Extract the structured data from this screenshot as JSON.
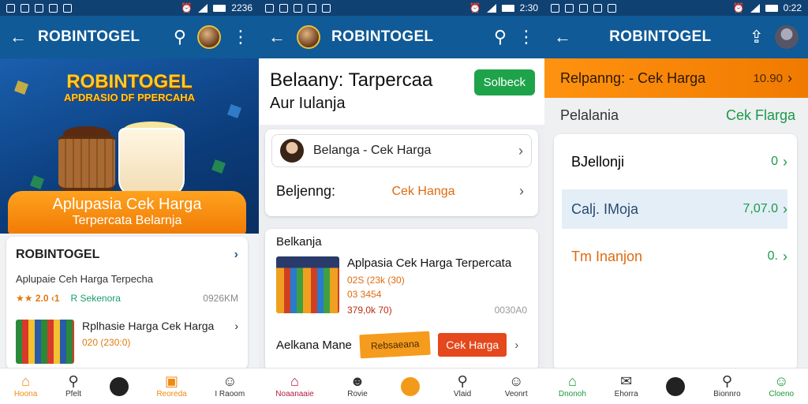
{
  "status": {
    "s1": {
      "time": "2236"
    },
    "s2": {
      "time": "2:30"
    },
    "s3": {
      "time": "0:22"
    }
  },
  "screen1": {
    "app_title": "ROBINTOGEL",
    "hero": {
      "title": "ROBINTOGEL",
      "subtitle": "APDRASIO DF PPERCAHA",
      "banner_line1": "Aplupasia Cek Harga",
      "banner_line2": "Terpercata Belarnja"
    },
    "card": {
      "title": "ROBINTOGEL",
      "subtitle": "Aplupaie Ceh Harga Terpecha",
      "rating": "2.0 ‹1",
      "category": "R Sekenora",
      "size": "0926KM",
      "product_title": "Rplhasie Harga Cek Harga",
      "product_price": "020 (230:0)"
    },
    "nav": [
      "Hoona",
      "Pfelt",
      "",
      "Reoreda",
      "I Raoom"
    ]
  },
  "screen2": {
    "app_title": "ROBINTOGEL",
    "heading1": "Belaany: Tarpercaa",
    "heading2": "Aur Iulanja",
    "green_button": "Solbeck",
    "row1_label": "Belanga - Cek Harga",
    "row2_label": "Beljenng:",
    "row2_value": "Cek Hanga",
    "section_title": "Belkanja",
    "product_title": "Aplpasia Cek Harga Terpercata",
    "price1": "02S (23k (30)",
    "price2": "03 3454",
    "price3": "379,0k 70)",
    "price3_right": "0030A0",
    "bottom_label": "Aelkana Mane",
    "orange_pill": "Rebsaeana",
    "red_button": "Cek Harga",
    "nav": [
      "Noaanaaie",
      "Rovie",
      "",
      "Vlaid",
      "Veonrt"
    ]
  },
  "screen3": {
    "app_title": "ROBINTOGEL",
    "banner_label": "Relpanng: - Cek Harga",
    "banner_value": "10.90",
    "row_left": "Pelalania",
    "row_right": "Cek Flarga",
    "items": [
      {
        "label": "BJellonji",
        "value": "0"
      },
      {
        "label": "Calj. IMoja",
        "value": "7,07.0"
      },
      {
        "label": "Tm Inanjon",
        "value": "0."
      }
    ],
    "nav": [
      "Dnonoh",
      "Ehorra",
      "",
      "Bionnro",
      "Cloeno"
    ]
  },
  "colors": {
    "statusbar": "#0f4173",
    "appbar": "#0f5a97",
    "accent_orange": "#f07a05",
    "accent_green": "#1fa34a"
  }
}
